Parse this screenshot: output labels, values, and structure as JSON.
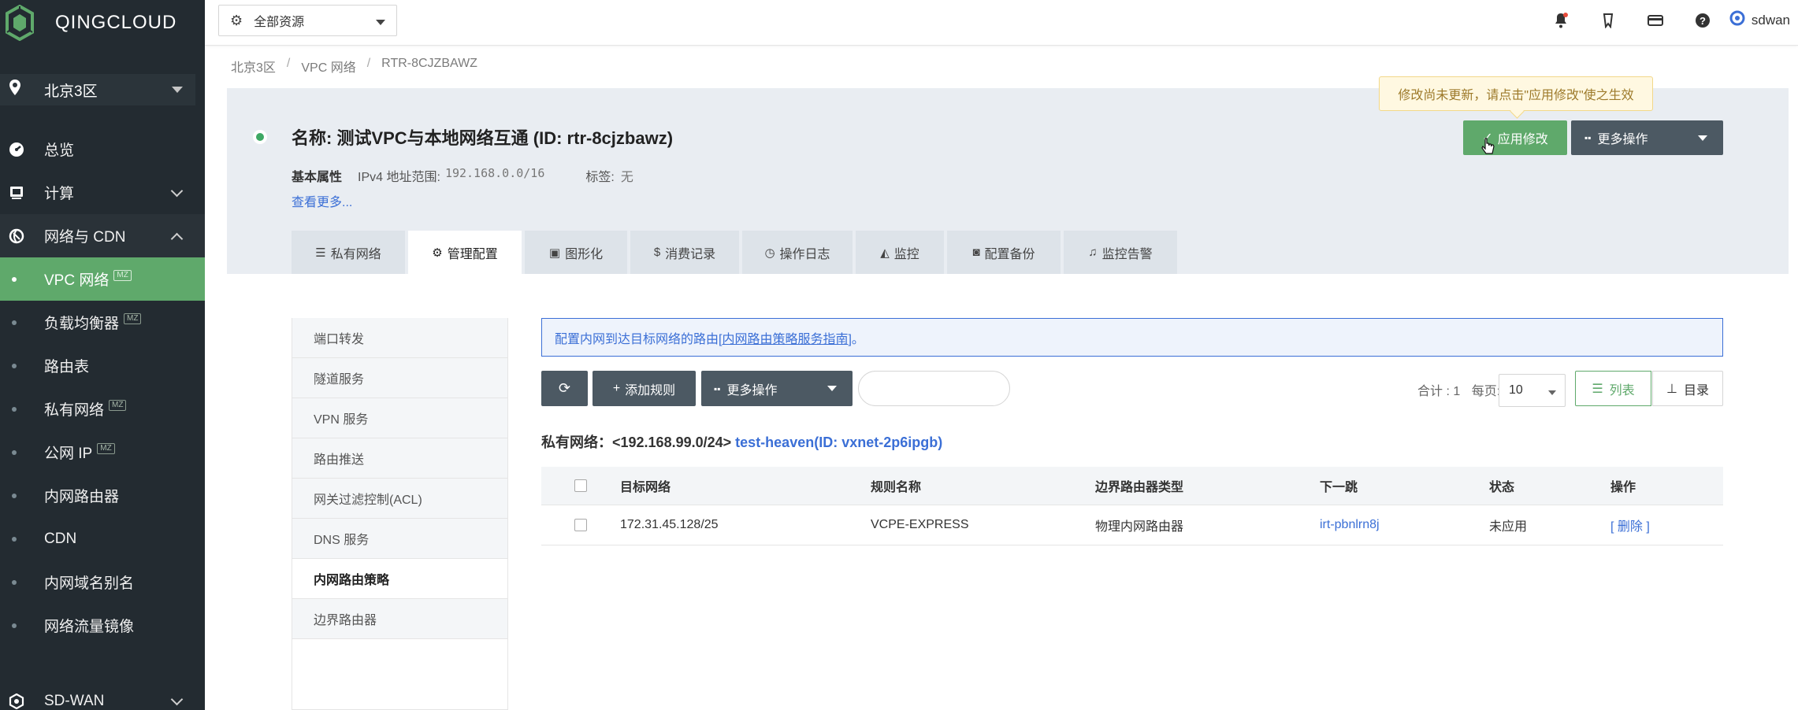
{
  "brand": {
    "name": "QINGCLOUD",
    "accent": "#5fa96b",
    "sidebar_bg": "#232b31"
  },
  "sidebar": {
    "region": "北京3区",
    "overview": "总览",
    "compute": "计算",
    "network_group": "网络与 CDN",
    "items": [
      {
        "label": "VPC 网络",
        "badge": "MZ",
        "active": true
      },
      {
        "label": "负载均衡器",
        "badge": "MZ"
      },
      {
        "label": "路由表"
      },
      {
        "label": "私有网络",
        "badge": "MZ"
      },
      {
        "label": "公网 IP",
        "badge": "MZ"
      },
      {
        "label": "内网路由器"
      },
      {
        "label": "CDN"
      },
      {
        "label": "内网域名别名"
      },
      {
        "label": "网络流量镜像"
      }
    ],
    "sdwan": "SD-WAN"
  },
  "topbar": {
    "resource_select": "全部资源",
    "icons": [
      "bell-icon",
      "bookmark-icon",
      "card-icon",
      "help-icon"
    ],
    "user": "sdwan"
  },
  "breadcrumb": [
    "北京3区",
    "VPC 网络",
    "RTR-8CJZBAWZ"
  ],
  "header": {
    "title": "名称: 测试VPC与本地网络互通 (ID: rtr-8cjzbawz)",
    "attr_label": "基本属性",
    "ipv4_label": "IPv4 地址范围:",
    "ipv4_value": "192.168.0.0/16",
    "tag_label": "标签:",
    "tag_value": "无",
    "see_more": "查看更多...",
    "tip": "修改尚未更新，请点击\"应用修改\"使之生效",
    "apply_button": "应用修改",
    "more_button": "更多操作",
    "status_color": "#3ea864"
  },
  "tabs": [
    {
      "label": "私有网络",
      "icon": "list-icon"
    },
    {
      "label": "管理配置",
      "icon": "cogs-icon",
      "active": true
    },
    {
      "label": "图形化",
      "icon": "image-icon"
    },
    {
      "label": "消费记录",
      "icon": "dollar-icon"
    },
    {
      "label": "操作日志",
      "icon": "clock-icon"
    },
    {
      "label": "监控",
      "icon": "area-chart-icon"
    },
    {
      "label": "配置备份",
      "icon": "camera-icon"
    },
    {
      "label": "监控告警",
      "icon": "bell-icon"
    }
  ],
  "submenu": [
    {
      "label": "端口转发"
    },
    {
      "label": "隧道服务"
    },
    {
      "label": "VPN 服务"
    },
    {
      "label": "路由推送"
    },
    {
      "label": "网关过滤控制(ACL)"
    },
    {
      "label": "DNS 服务"
    },
    {
      "label": "内网路由策略",
      "active": true
    },
    {
      "label": "边界路由器"
    }
  ],
  "info": {
    "prefix": "配置内网到达目标网络的路由[",
    "link": "内网路由策略服务指南",
    "suffix": "]。"
  },
  "toolbar": {
    "add_rule": "添加规则",
    "more": "更多操作",
    "total": "合计 : 1",
    "per_page_label": "每页:",
    "per_page": "10",
    "view_list": "列表",
    "view_dir": "目录"
  },
  "network": {
    "label": "私有网络：",
    "cidr": "<192.168.99.0/24>",
    "link": "test-heaven(ID: vxnet-2p6ipgb)"
  },
  "table": {
    "headers": [
      "目标网络",
      "规则名称",
      "边界路由器类型",
      "下一跳",
      "状态",
      "操作"
    ],
    "rows": [
      {
        "target": "172.31.45.128/25",
        "name": "VCPE-EXPRESS",
        "router_type": "物理内网路由器",
        "next_hop": "irt-pbnlrn8j",
        "status": "未应用",
        "action": "[ 删除 ]"
      }
    ]
  }
}
